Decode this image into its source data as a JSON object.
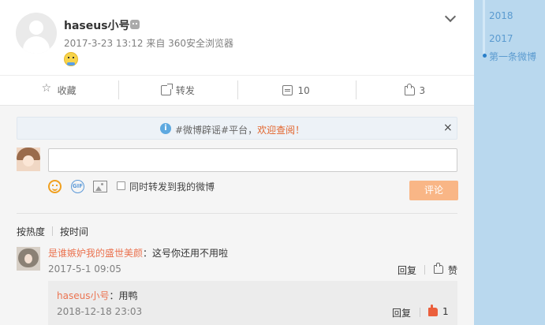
{
  "post": {
    "username": "haseus小号",
    "meta": "2017-3-23 13:12 来自 360安全浏览器"
  },
  "actions": {
    "favorite": "收藏",
    "forward": "转发",
    "comment_count": "10",
    "like_count": "3"
  },
  "notice": {
    "prefix": "#微博辟谣#平台，",
    "highlight": "欢迎查阅！",
    "close": "×"
  },
  "composer": {
    "gif": "GIF",
    "checkbox_label": "同时转发到我的微博",
    "submit": "评论"
  },
  "sort": {
    "hot": "按热度",
    "time": "按时间"
  },
  "comments": [
    {
      "author": "是谁嫉妒我的盛世美颜",
      "text": "：这号你还用不用啦",
      "time": "2017-5-1 09:05",
      "reply": "回复",
      "like": "赞",
      "replies": [
        {
          "author": "haseus小号",
          "text": "：用鸭",
          "time": "2018-12-18 23:03",
          "reply": "回复",
          "like_count": "1"
        }
      ]
    }
  ],
  "timeline": {
    "years": [
      "2018",
      "2017"
    ],
    "first": "第一条微博"
  },
  "colors": {
    "link": "#eb7350",
    "accent": "#f9b686",
    "timeline_bg": "#b9d8ee"
  }
}
